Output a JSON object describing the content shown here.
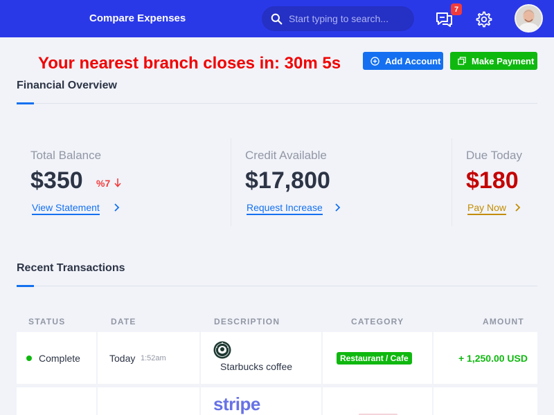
{
  "header": {
    "title": "Compare Expenses",
    "search_placeholder": "Start typing to search...",
    "notification_count": "7"
  },
  "alert": {
    "countdown": "Your nearest branch closes in: 30m 5s"
  },
  "actions": {
    "add_account": "Add Account",
    "make_payment": "Make Payment"
  },
  "overview": {
    "title": "Financial Overview",
    "stats": [
      {
        "label": "Total Balance",
        "value": "$350",
        "change": "%7",
        "link": "View Statement",
        "color": "#2c3445",
        "link_color": "#1470f0"
      },
      {
        "label": "Credit Available",
        "value": "$17,800",
        "link": "Request Increase",
        "color": "#2c3445",
        "link_color": "#1470f0"
      },
      {
        "label": "Due Today",
        "value": "$180",
        "link": "Pay Now",
        "color": "#c40000",
        "link_color": "#c48c00"
      }
    ]
  },
  "transactions": {
    "title": "Recent Transactions",
    "columns": [
      "STATUS",
      "DATE",
      "DESCRIPTION",
      "CATEGORY",
      "AMOUNT"
    ],
    "rows": [
      {
        "status": "Complete",
        "date": "Today",
        "time": "1:52am",
        "description": "Starbucks coffee",
        "category": "Restaurant / Cafe",
        "amount": "+ 1,250.00 USD"
      },
      {
        "logo": "stripe"
      }
    ]
  },
  "colors": {
    "brand": "#2a39e8",
    "accent": "#1470f0",
    "success": "#0fb80f",
    "danger": "#f10000"
  }
}
